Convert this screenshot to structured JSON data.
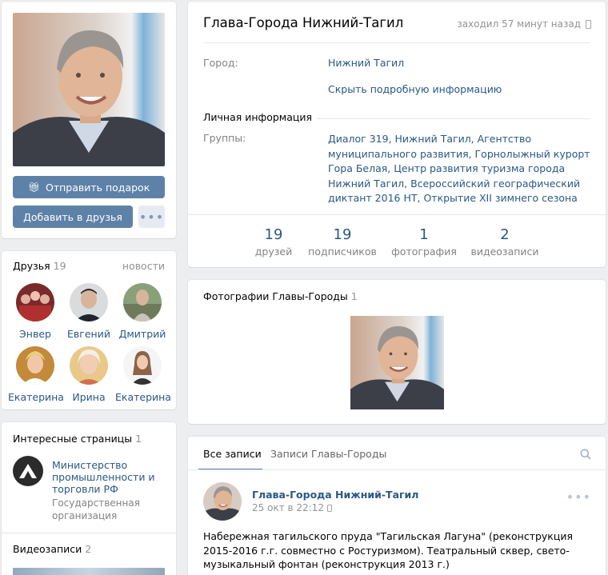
{
  "profile": {
    "name": "Глава-Города Нижний-Тагил",
    "last_seen": "заходил 57 минут назад",
    "city_label": "Город:",
    "city_value": "Нижний Тагил",
    "hide_details": "Скрыть подробную информацию",
    "personal_info_title": "Личная информация",
    "groups_label": "Группы:",
    "groups_value": "Диалог 319, Нижний Тагил, Агентство муниципального развития, Горнолыжный курорт Гора Белая, Центр развития туризма города Нижний Тагил, Всероссийский географический диктант 2016 НТ, Открытие XII зимнего сезона"
  },
  "buttons": {
    "gift": "Отправить подарок",
    "add_friend": "Добавить в друзья",
    "more": "•••"
  },
  "counters": [
    {
      "value": "19",
      "label": "друзей"
    },
    {
      "value": "19",
      "label": "подписчиков"
    },
    {
      "value": "1",
      "label": "фотография"
    },
    {
      "value": "2",
      "label": "видеозаписи"
    }
  ],
  "friends": {
    "title": "Друзья",
    "count": "19",
    "news_link": "новости",
    "items": [
      {
        "name": "Энвер"
      },
      {
        "name": "Евгений"
      },
      {
        "name": "Дмитрий"
      },
      {
        "name": "Екатерина"
      },
      {
        "name": "Ирина"
      },
      {
        "name": "Екатерина"
      }
    ]
  },
  "interesting_pages": {
    "title": "Интересные страницы",
    "count": "1",
    "item_name": "Министерство промышленности и торговли РФ",
    "item_type": "Государственная организация"
  },
  "videos": {
    "title": "Видеозаписи",
    "count": "2"
  },
  "photos": {
    "title": "Фотографии Главы-Городы",
    "count": "1"
  },
  "wall": {
    "tab_all": "Все записи",
    "tab_owner": "Записи Главы-Городы",
    "post": {
      "author": "Глава-Города Нижний-Тагил",
      "date": "25 окт в 22:12",
      "text": "Набережная тагильского пруда \"Тагильская Лагуна\" (реконструкция 2015-2016 г.г. совместно с Ростуризмом). Театральный сквер, свето-музыкальный фонтан (реконструкция 2013 г.)"
    }
  },
  "colors": {
    "accent": "#5e81a8",
    "link": "#2a5885",
    "background": "#edeef0"
  }
}
